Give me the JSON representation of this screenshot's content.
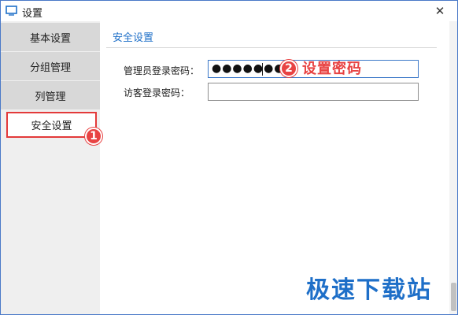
{
  "window": {
    "title": "设置",
    "close_symbol": "✕"
  },
  "sidebar": {
    "items": [
      {
        "label": "基本设置"
      },
      {
        "label": "分组管理"
      },
      {
        "label": "列管理"
      },
      {
        "label": "安全设置",
        "active": true
      }
    ]
  },
  "content": {
    "section_title": "安全设置",
    "fields": [
      {
        "label": "管理员登录密码：",
        "value": "●●●●●●●●"
      },
      {
        "label": "访客登录密码：",
        "value": ""
      }
    ]
  },
  "annotations": {
    "badge1": "1",
    "badge2": "2",
    "note": "设置密码"
  },
  "watermark": "极速下载站",
  "colors": {
    "accent": "#1e6fc8",
    "highlight_red": "#e84343",
    "border_blue": "#4a79c8"
  },
  "icons": {
    "app": "window-app-icon",
    "close": "close-icon"
  }
}
